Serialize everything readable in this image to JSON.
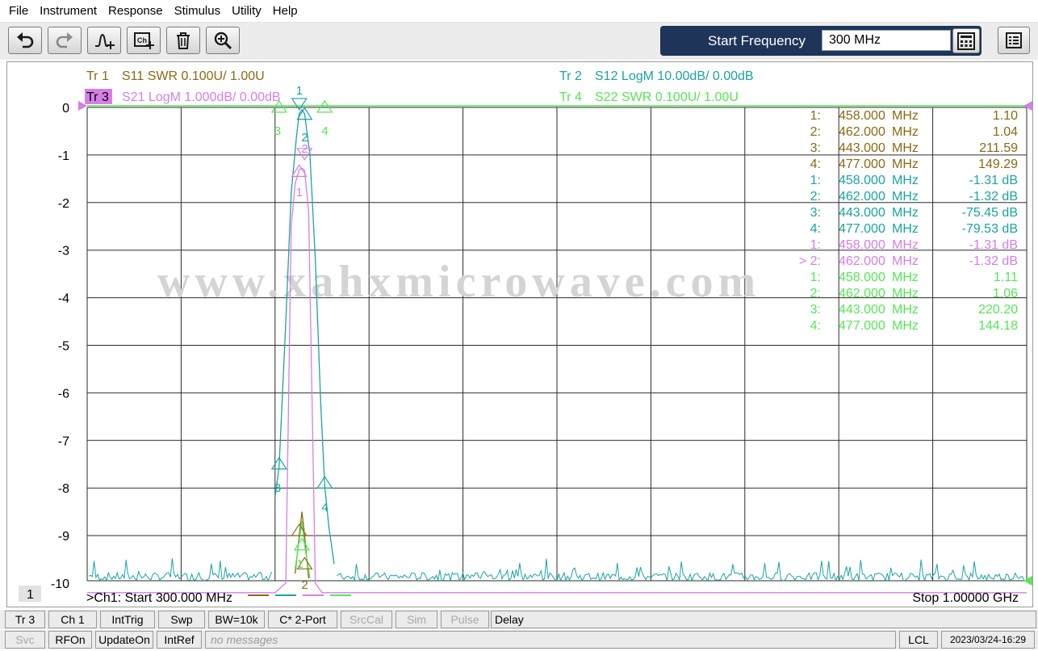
{
  "menu": [
    "File",
    "Instrument",
    "Response",
    "Stimulus",
    "Utility",
    "Help"
  ],
  "toolbar": {
    "icons": [
      "undo-icon",
      "redo-icon",
      "add-trace-icon",
      "add-channel-icon",
      "delete-icon",
      "zoom-icon"
    ],
    "entry_label": "Start Frequency",
    "entry_value": "300 MHz"
  },
  "traces": {
    "tr1": {
      "id": "Tr  1",
      "text": "S11 SWR 0.100U/  1.00U",
      "color": "#8b6914"
    },
    "tr2": {
      "id": "Tr  2",
      "text": "S12 LogM 10.00dB/  0.00dB",
      "color": "#1aa3a3"
    },
    "tr3": {
      "id": "Tr  3",
      "text": "S21 LogM 1.000dB/  0.00dB",
      "color": "#d67ee6"
    },
    "tr4": {
      "id": "Tr  4",
      "text": "S22 SWR 0.100U/  1.00U",
      "color": "#55e655"
    }
  },
  "watermark": "www.xahxmicrowave.com",
  "markers": [
    {
      "n": "1:",
      "freq": "458.000",
      "unit": "MHz",
      "val": "1.10",
      "trace": "tr1"
    },
    {
      "n": "2:",
      "freq": "462.000",
      "unit": "MHz",
      "val": "1.04",
      "trace": "tr1"
    },
    {
      "n": "3:",
      "freq": "443.000",
      "unit": "MHz",
      "val": "211.59",
      "trace": "tr1"
    },
    {
      "n": "4:",
      "freq": "477.000",
      "unit": "MHz",
      "val": "149.29",
      "trace": "tr1"
    },
    {
      "n": "1:",
      "freq": "458.000",
      "unit": "MHz",
      "val": "-1.31 dB",
      "trace": "tr2"
    },
    {
      "n": "2:",
      "freq": "462.000",
      "unit": "MHz",
      "val": "-1.32 dB",
      "trace": "tr2"
    },
    {
      "n": "3:",
      "freq": "443.000",
      "unit": "MHz",
      "val": "-75.45 dB",
      "trace": "tr2"
    },
    {
      "n": "4:",
      "freq": "477.000",
      "unit": "MHz",
      "val": "-79.53 dB",
      "trace": "tr2"
    },
    {
      "n": "1:",
      "freq": "458.000",
      "unit": "MHz",
      "val": "-1.31 dB",
      "trace": "tr3"
    },
    {
      "n": "> 2:",
      "freq": "462.000",
      "unit": "MHz",
      "val": "-1.32 dB",
      "trace": "tr3"
    },
    {
      "n": "1:",
      "freq": "458.000",
      "unit": "MHz",
      "val": "1.11",
      "trace": "tr4"
    },
    {
      "n": "2:",
      "freq": "462.000",
      "unit": "MHz",
      "val": "1.06",
      "trace": "tr4"
    },
    {
      "n": "3:",
      "freq": "443.000",
      "unit": "MHz",
      "val": "220.20",
      "trace": "tr4"
    },
    {
      "n": "4:",
      "freq": "477.000",
      "unit": "MHz",
      "val": "144.18",
      "trace": "tr4"
    }
  ],
  "chart_data": {
    "type": "line",
    "y_ticks": [
      "0",
      "-1",
      "-2",
      "-3",
      "-4",
      "-5",
      "-6",
      "-7",
      "-8",
      "-9",
      "-10"
    ],
    "ylim": [
      -10.2,
      0
    ],
    "xlim_mhz": [
      300,
      1000
    ],
    "x_divisions": 10,
    "grid": true,
    "channel_label": "1",
    "start_label": ">Ch1:  Start  300.000 MHz",
    "stop_label": "Stop  1.00000 GHz",
    "series": [
      {
        "trace": "tr3",
        "points_mhz_db": [
          [
            300,
            -10.2
          ],
          [
            440,
            -10.2
          ],
          [
            448,
            -10.0
          ],
          [
            452,
            -2.5
          ],
          [
            455,
            -1.6
          ],
          [
            458,
            -1.31
          ],
          [
            460,
            -1.28
          ],
          [
            462,
            -1.32
          ],
          [
            465,
            -2.2
          ],
          [
            470,
            -10.0
          ],
          [
            475,
            -10.2
          ],
          [
            1000,
            -10.2
          ]
        ]
      },
      {
        "trace": "tr2",
        "points_mhz_db": [
          [
            440,
            -8.2
          ],
          [
            443,
            -7.55
          ],
          [
            448,
            -4.5
          ],
          [
            452,
            -1.8
          ],
          [
            456,
            -0.6
          ],
          [
            458,
            -0.131
          ],
          [
            460,
            -0.05
          ],
          [
            462,
            -0.132
          ],
          [
            466,
            -1.0
          ],
          [
            470,
            -3.2
          ],
          [
            474,
            -6.2
          ],
          [
            477,
            -7.95
          ],
          [
            480,
            -8.8
          ],
          [
            484,
            -9.6
          ]
        ]
      },
      {
        "trace": "tr1",
        "points_mhz_db": [
          [
            455,
            -9.8
          ],
          [
            458,
            -9.0
          ],
          [
            460,
            -8.5
          ],
          [
            462,
            -9.0
          ],
          [
            465,
            -9.9
          ]
        ]
      },
      {
        "trace": "tr4",
        "points_mhz_db": [
          [
            455,
            -9.7
          ],
          [
            458,
            -9.1
          ],
          [
            460,
            -8.7
          ],
          [
            462,
            -9.2
          ],
          [
            466,
            -9.9
          ]
        ]
      }
    ]
  },
  "status1": [
    "Tr 3",
    "Ch 1",
    "IntTrig",
    "Swp",
    "BW=10k",
    "C* 2-Port",
    "SrcCal",
    "Sim",
    "Pulse",
    "Delay"
  ],
  "status2": [
    "Svc",
    "RFOn",
    "UpdateOn",
    "IntRef",
    "no messages",
    "LCL",
    "2023/03/24-16:29"
  ]
}
